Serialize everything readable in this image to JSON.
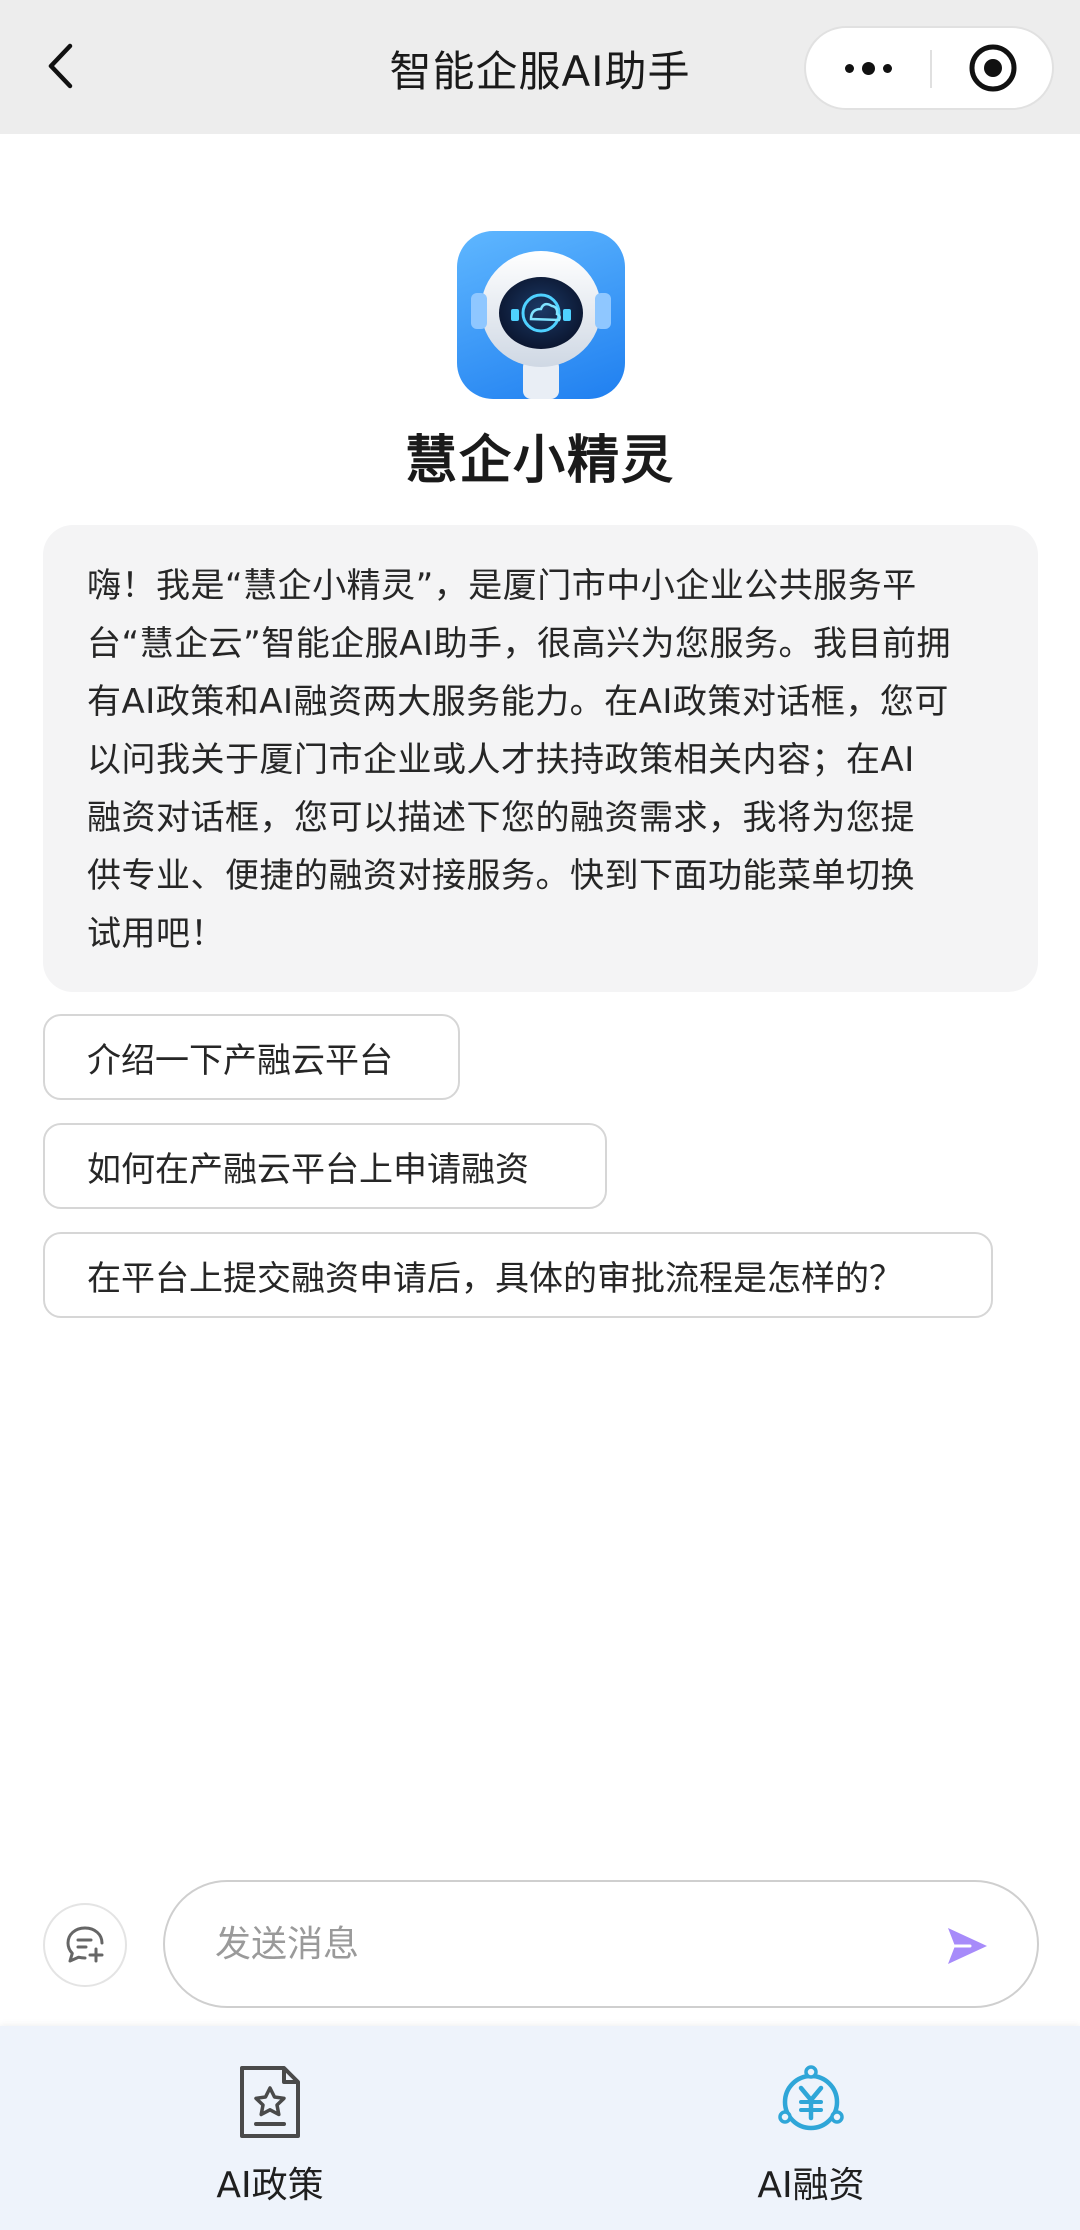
{
  "header": {
    "title": "智能企服AI助手"
  },
  "bot": {
    "name": "慧企小精灵"
  },
  "greeting": {
    "lines": [
      "嗨！我是“慧企小精灵”，是厦门市中小企业公共服务平",
      "台“慧企云”智能企服AI助手，很高兴为您服务。我目前拥",
      "有AI政策和AI融资两大服务能力。在AI政策对话框，您可",
      "以问我关于厦门市企业或人才扶持政策相关内容；在AI",
      "融资对话框，您可以描述下您的融资需求，我将为您提",
      "供专业、便捷的融资对接服务。快到下面功能菜单切换",
      "试用吧！"
    ]
  },
  "suggestions": [
    "介绍一下产融云平台",
    "如何在产融云平台上申请融资",
    "在平台上提交融资申请后，具体的审批流程是怎样的？"
  ],
  "composer": {
    "placeholder": "发送消息",
    "value": ""
  },
  "bottom_nav": {
    "items": [
      {
        "label": "AI政策",
        "icon": "policy-document-icon"
      },
      {
        "label": "AI融资",
        "icon": "finance-yuan-icon"
      }
    ]
  },
  "colors": {
    "header_bg": "#ededed",
    "bubble_bg": "#f4f4f5",
    "send_accent": "#a78bfa",
    "finance_icon": "#2fa6d8",
    "nav_bg": "#eef3fb"
  }
}
